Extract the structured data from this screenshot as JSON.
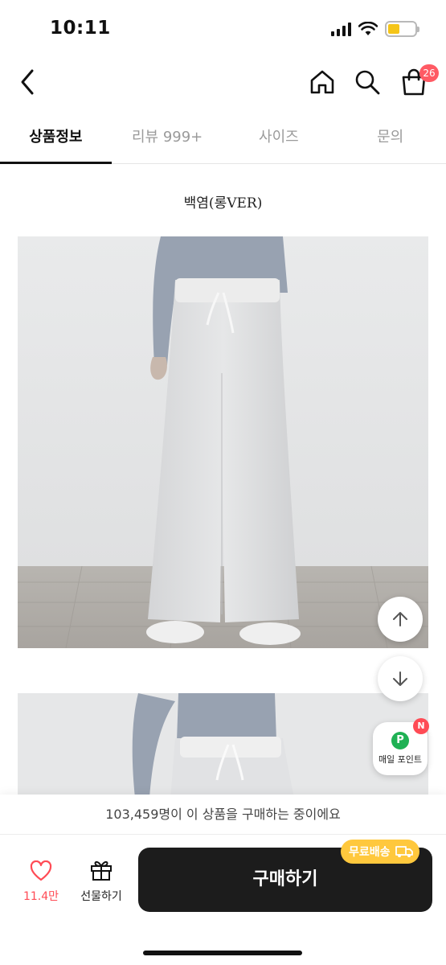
{
  "status_bar": {
    "time": "10:11"
  },
  "header": {
    "cart_count": "26"
  },
  "tabs": [
    {
      "label": "상품정보",
      "active": true
    },
    {
      "label": "리뷰 999+",
      "active": false
    },
    {
      "label": "사이즈",
      "active": false
    },
    {
      "label": "문의",
      "active": false
    }
  ],
  "product": {
    "caption": "백염(롱VER)"
  },
  "floating": {
    "point_label": "매일 포인트",
    "point_icon_letter": "P",
    "new_badge": "N"
  },
  "bottom": {
    "purchase_notice": "103,459명이 이 상품을 구매하는 중이에요",
    "like_count": "11.4만",
    "gift_label": "선물하기",
    "buy_label": "구매하기",
    "shipping_badge": "무료배송"
  },
  "colors": {
    "accent_red": "#ff4b55",
    "buy_button": "#1c1c1c",
    "shipping_yellow": "#ffc83d",
    "point_green": "#1fb154"
  }
}
